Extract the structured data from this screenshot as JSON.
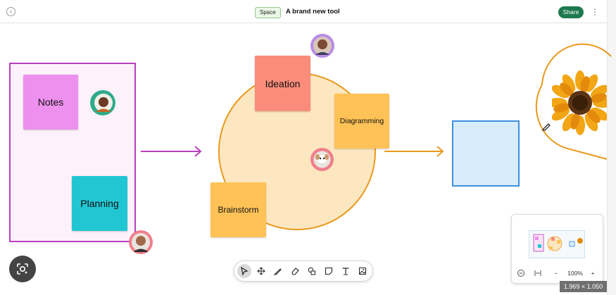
{
  "header": {
    "back_icon": "chevron-left-icon",
    "space_tag": "Space",
    "title": "A brand new tool",
    "share_label": "Share",
    "more_icon": "more-vertical-icon"
  },
  "canvas": {
    "stickies": [
      {
        "label": "Notes",
        "color": "#ee90ee"
      },
      {
        "label": "Planning",
        "color": "#22c6d3"
      },
      {
        "label": "Ideation",
        "color": "#fb8c7b"
      },
      {
        "label": "Diagramming",
        "color": "#fec257"
      },
      {
        "label": "Brainstorm",
        "color": "#fec257"
      }
    ],
    "frame_color": "#b93fbd",
    "circle_color": "#e99a1e",
    "blue_square_color": "#3c8fde",
    "sunflower_icon": "sunflower-image",
    "pencil_icon": "pencil-icon"
  },
  "minimap": {
    "fit_icon": "fit-width-icon",
    "zoom_out": "−",
    "zoom_level": "100%",
    "zoom_in": "+"
  },
  "toolbar": {
    "tools": [
      "select-tool",
      "move-tool",
      "pen-tool",
      "eraser-tool",
      "shapes-tool",
      "sticky-note-tool",
      "text-tool",
      "image-tool"
    ],
    "active": "select-tool"
  },
  "overlay": {
    "dimensions": "1.969 × 1.050"
  }
}
